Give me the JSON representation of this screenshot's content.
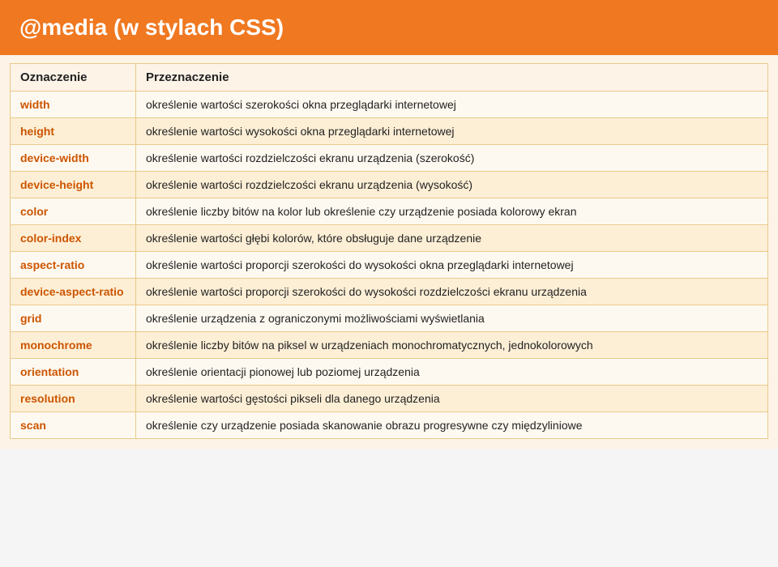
{
  "header": {
    "title": "@media (w stylach CSS)"
  },
  "table": {
    "columns": [
      "Oznaczenie",
      "Przeznaczenie"
    ],
    "rows": [
      {
        "term": "width",
        "desc": "określenie wartości szerokości okna przeglądarki internetowej"
      },
      {
        "term": "height",
        "desc": "określenie wartości wysokości okna przeglądarki internetowej"
      },
      {
        "term": "device-width",
        "desc": "określenie wartości rozdzielczości ekranu urządzenia (szerokość)"
      },
      {
        "term": "device-height",
        "desc": "określenie wartości rozdzielczości ekranu urządzenia (wysokość)"
      },
      {
        "term": "color",
        "desc": "określenie liczby bitów na kolor lub określenie czy urządzenie posiada kolorowy ekran"
      },
      {
        "term": "color-index",
        "desc": "określenie wartości głębi kolorów, które obsługuje dane urządzenie"
      },
      {
        "term": "aspect-ratio",
        "desc": "określenie wartości proporcji szerokości do wysokości okna przeglądarki internetowej"
      },
      {
        "term": "device-aspect-ratio",
        "desc": "określenie wartości proporcji szerokości do wysokości rozdzielczości ekranu urządzenia"
      },
      {
        "term": "grid",
        "desc": "określenie urządzenia z ograniczonymi możliwościami wyświetlania"
      },
      {
        "term": "monochrome",
        "desc": "określenie liczby bitów na piksel w urządzeniach monochromatycznych, jednokolorowych"
      },
      {
        "term": "orientation",
        "desc": "określenie orientacji pionowej lub poziomej urządzenia"
      },
      {
        "term": "resolution",
        "desc": "określenie wartości gęstości pikseli dla danego urządzenia"
      },
      {
        "term": "scan",
        "desc": "określenie czy urządzenie posiada skanowanie obrazu progresywne czy międzyliniowe"
      }
    ]
  }
}
